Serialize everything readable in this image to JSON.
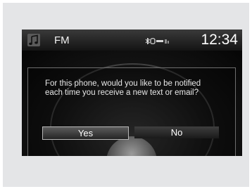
{
  "status_bar": {
    "source_icon": "music-note-icon",
    "source_label": "FM",
    "indicators": [
      "bluetooth-icon",
      "phone-icon",
      "signal-icon"
    ],
    "clock": "12:34"
  },
  "dialog": {
    "message": "For this phone, would you like to be notified each time you receive a new text or email?",
    "buttons": [
      {
        "label": "Yes",
        "selected": true
      },
      {
        "label": "No",
        "selected": false
      }
    ]
  },
  "colors": {
    "panel_bg": "#e4e5e7",
    "screen_bg": "#000000",
    "text": "#ffffff"
  }
}
